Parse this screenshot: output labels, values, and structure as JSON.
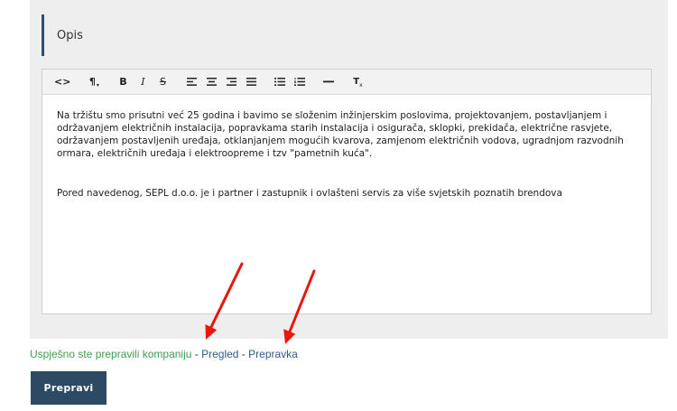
{
  "field": {
    "label": "Opis"
  },
  "toolbar": {
    "code_label": "<>",
    "paragraph_label": "¶",
    "bold_label": "B",
    "italic_label": "I",
    "strike_label": "S",
    "clear_label": "T"
  },
  "editor": {
    "paragraphs": [
      "Na tržištu smo prisutni već 25 godina i bavimo se složenim inžinjerskim poslovima, projektovanjem, postavljanjem i održavanjem električnih instalacija, popravkama starih instalacija i osigurača, sklopki, prekidača, električne rasvjete, održavanjem postavljenih uređaja, otklanjanjem mogućih kvarova, zamjenom električnih vodova, ugradnjom razvodnih ormara, električnih uređaja i elektroopreme i tzv \"pametnih kuća\".",
      "Pored navedenog, SEPL d.o.o. je i partner i zastupnik i ovlašteni servis za više svjetskih poznatih brendova"
    ]
  },
  "status": {
    "message": "Uspješno ste prepravili kompaniju",
    "separator": " - ",
    "preview_link": "Pregled",
    "edit_link": "Prepravka"
  },
  "submit": {
    "label": "Prepravi"
  },
  "colors": {
    "success": "#3ea14a",
    "link": "#2a5d8c",
    "button": "#2c4a63",
    "arrow": "#e8160c"
  }
}
